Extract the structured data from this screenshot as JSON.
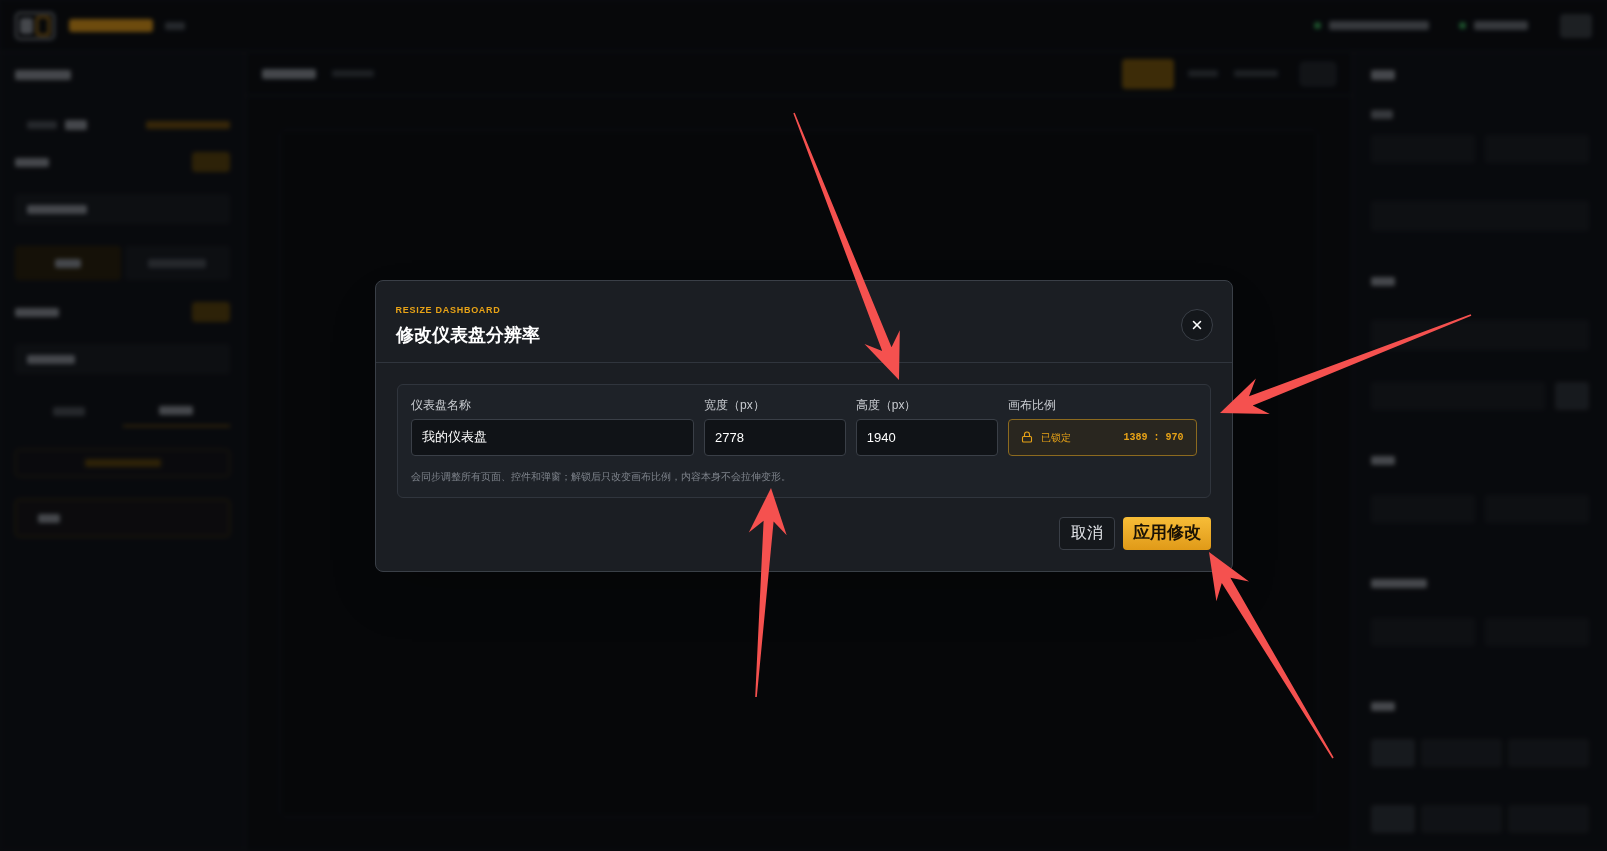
{
  "dialog": {
    "eyebrow": "RESIZE DASHBOARD",
    "title": "修改仪表盘分辨率",
    "fields": [
      {
        "kind": "text",
        "label": "仪表盘名称",
        "value": "我的仪表盘"
      },
      {
        "kind": "text",
        "label": "宽度（px）",
        "value": "2778"
      },
      {
        "kind": "text",
        "label": "高度（px）",
        "value": "1940"
      },
      {
        "kind": "ratio",
        "label": "画布比例",
        "locked": true,
        "status": "已锁定",
        "ratio": "1389 : 970"
      }
    ],
    "hint": "会同步调整所有页面、控件和弹窗；解锁后只改变画布比例，内容本身不会拉伸变形。",
    "buttons": [
      {
        "kind": "secondary",
        "label": "取消"
      },
      {
        "kind": "primary",
        "label": "应用修改"
      }
    ]
  }
}
